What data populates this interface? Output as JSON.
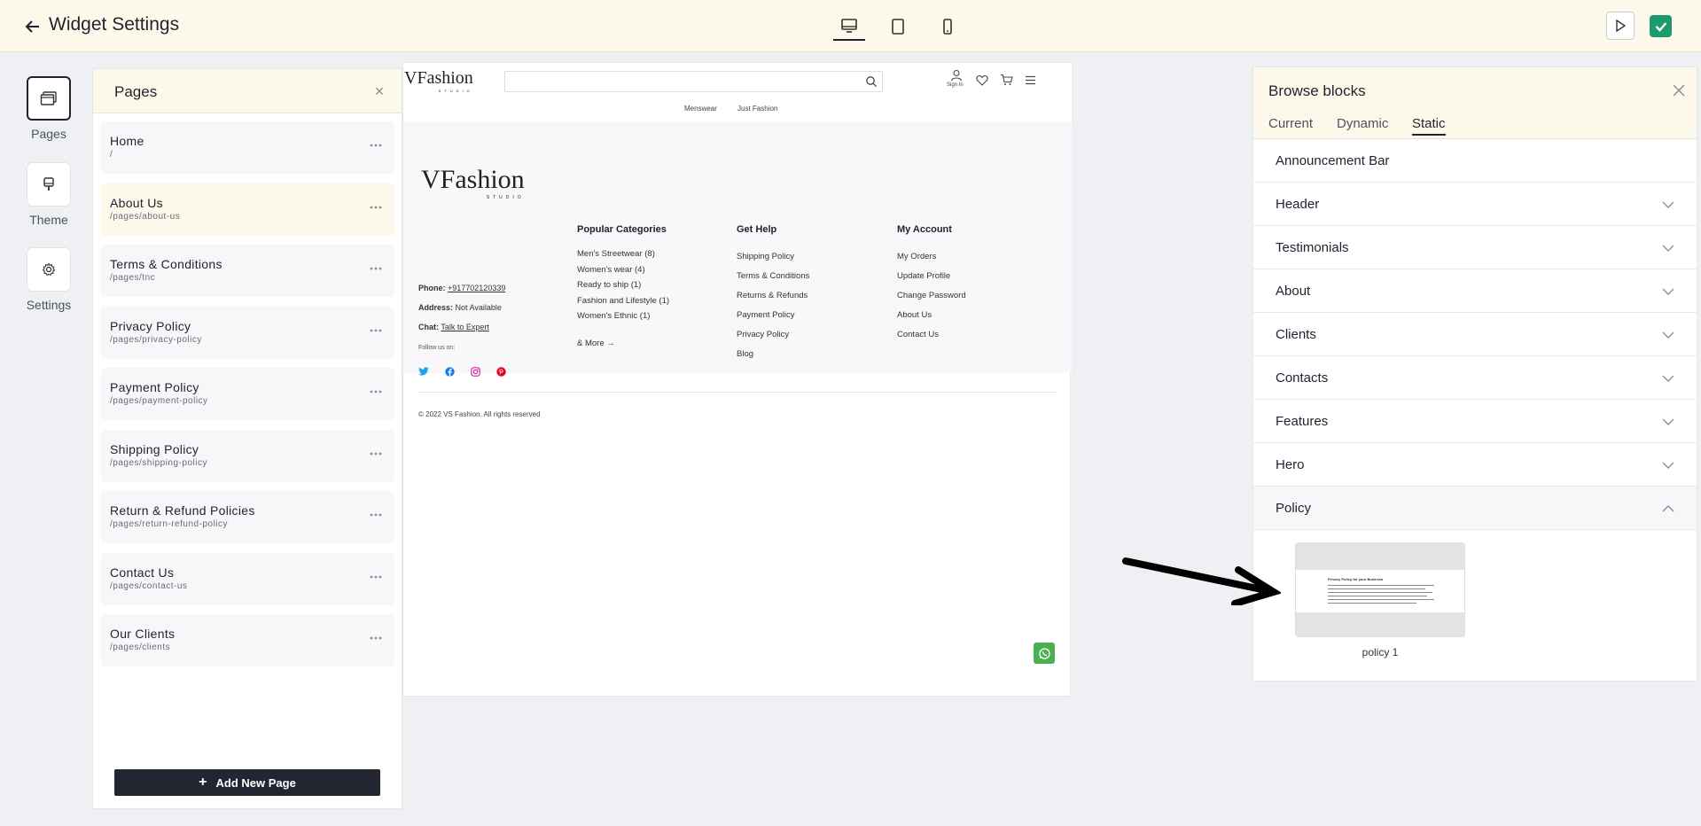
{
  "topbar": {
    "title": "Widget Settings",
    "devices": [
      "desktop-icon",
      "tablet-icon",
      "mobile-icon"
    ],
    "active_device": "desktop"
  },
  "rail": {
    "items": [
      {
        "label": "Pages",
        "icon": "pages-icon"
      },
      {
        "label": "Theme",
        "icon": "theme-icon"
      },
      {
        "label": "Settings",
        "icon": "gear-icon"
      }
    ]
  },
  "pages": {
    "title": "Pages",
    "items": [
      {
        "name": "Home",
        "path": "/"
      },
      {
        "name": "About Us",
        "path": "/pages/about-us"
      },
      {
        "name": "Terms & Conditions",
        "path": "/pages/tnc"
      },
      {
        "name": "Privacy Policy",
        "path": "/pages/privacy-policy"
      },
      {
        "name": "Payment Policy",
        "path": "/pages/payment-policy"
      },
      {
        "name": "Shipping Policy",
        "path": "/pages/shipping-policy"
      },
      {
        "name": "Return & Refund Policies",
        "path": "/pages/return-refund-policy"
      },
      {
        "name": "Contact Us",
        "path": "/pages/contact-us"
      },
      {
        "name": "Our Clients",
        "path": "/pages/clients"
      }
    ],
    "add_label": "Add New Page"
  },
  "site": {
    "logo_text": "VFashion",
    "logo_sub": "STUDIO",
    "signin": "Sign In",
    "nav": [
      "Menswear",
      "Just Fashion"
    ],
    "contact": {
      "phone_label": "Phone:",
      "phone": "+917702120339",
      "address_label": "Address:",
      "address": "Not Available",
      "chat_label": "Chat:",
      "chat": "Talk to Expert",
      "follow": "Follow us on:"
    },
    "columns": {
      "popular": {
        "title": "Popular Categories",
        "links": [
          "Men's Streetwear (8)",
          "Women's wear (4)",
          "Ready to ship (1)",
          "Fashion and Lifestyle (1)",
          "Women's Ethnic (1)"
        ],
        "more": "& More"
      },
      "help": {
        "title": "Get Help",
        "links": [
          "Shipping Policy",
          "Terms & Conditions",
          "Returns & Refunds",
          "Payment Policy",
          "Privacy Policy",
          "Blog"
        ]
      },
      "account": {
        "title": "My Account",
        "links": [
          "My Orders",
          "Update Profile",
          "Change Password",
          "About Us",
          "Contact Us"
        ]
      }
    },
    "copyright": "© 2022 VS Fashion. All rights reserved"
  },
  "blocks": {
    "title": "Browse blocks",
    "tabs": [
      "Current",
      "Dynamic",
      "Static"
    ],
    "active_tab": "Static",
    "items": [
      "Announcement Bar",
      "Header",
      "Testimonials",
      "About",
      "Clients",
      "Contacts",
      "Features",
      "Hero",
      "Policy"
    ],
    "expanded": "Policy",
    "policy_thumb_title": "Privacy Policy for your Business",
    "policy_caption": "policy 1"
  },
  "colors": {
    "topbar_bg": "#fdf9ea",
    "accent_dark": "#232530",
    "publish_green": "#1e9b6e",
    "whatsapp_green": "#4caf50"
  }
}
